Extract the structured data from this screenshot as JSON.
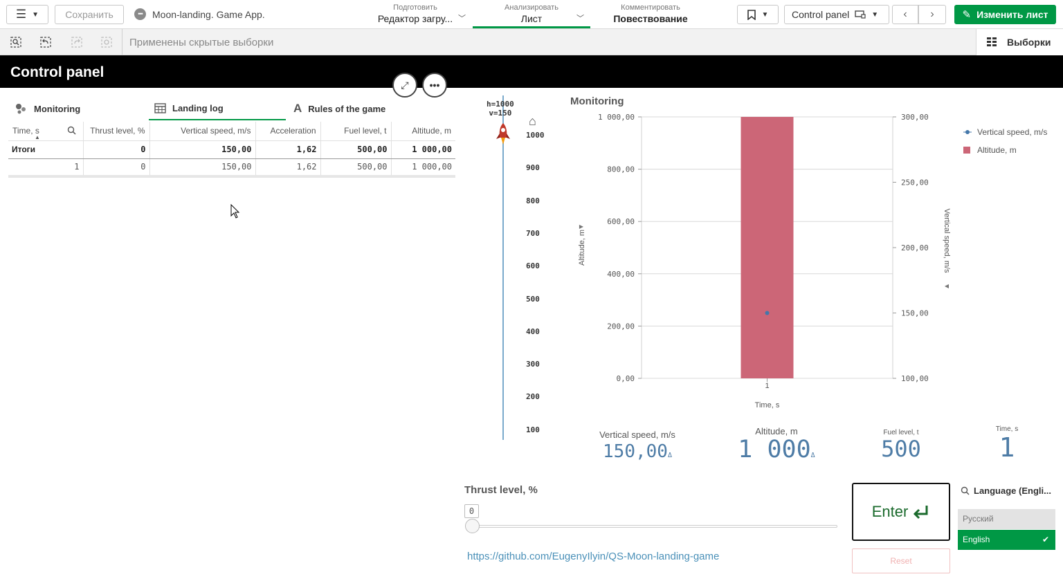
{
  "toolbar": {
    "save_label": "Сохранить",
    "app_name": "Moon-landing. Game App.",
    "nav": [
      {
        "small": "Подготовить",
        "big": "Редактор загру..."
      },
      {
        "small": "Анализировать",
        "big": "Лист"
      },
      {
        "small": "Комментировать",
        "big": "Повествование"
      }
    ],
    "sheet_name": "Control panel",
    "edit_label": "Изменить лист"
  },
  "selections": {
    "text": "Применены скрытые выборки",
    "right_label": "Выборки"
  },
  "sheet": {
    "title": "Control panel"
  },
  "tabs": [
    {
      "label": "Monitoring",
      "icon": "scatter-icon"
    },
    {
      "label": "Landing log",
      "icon": "table-icon"
    },
    {
      "label": "Rules of the game",
      "icon": "text-icon"
    }
  ],
  "log_table": {
    "headers": [
      "Time, s",
      "Thrust level, %",
      "Vertical speed, m/s",
      "Acceleration",
      "Fuel level, t",
      "Altitude, m"
    ],
    "totals": [
      "Итоги",
      "0",
      "150,00",
      "1,62",
      "500,00",
      "1 000,00"
    ],
    "rows": [
      [
        "1",
        "0",
        "150,00",
        "1,62",
        "500,00",
        "1 000,00"
      ]
    ]
  },
  "gauge": {
    "h_label": "h=1000",
    "v_label": "v=150",
    "ticks": [
      "1000",
      "900",
      "800",
      "700",
      "600",
      "500",
      "400",
      "300",
      "200",
      "100"
    ]
  },
  "chart": {
    "title": "Monitoring",
    "legend": [
      "Vertical speed, m/s",
      "Altitude, m"
    ],
    "colors": {
      "bar": "#cc6677",
      "point": "#4477aa"
    }
  },
  "chart_data": {
    "type": "bar",
    "categories": [
      "1"
    ],
    "series": [
      {
        "name": "Altitude, m",
        "type": "bar",
        "axis": "left",
        "values": [
          1000
        ]
      },
      {
        "name": "Vertical speed, m/s",
        "type": "scatter",
        "axis": "right",
        "values": [
          150
        ]
      }
    ],
    "xlabel": "Time, s",
    "ylabel": "Altitude, m",
    "y2label": "Vertical speed, m/s",
    "ylim": [
      0,
      1000
    ],
    "y2lim": [
      100,
      300
    ],
    "yticks": [
      "0,00",
      "200,00",
      "400,00",
      "600,00",
      "800,00",
      "1 000,00"
    ],
    "y2ticks": [
      "100,00",
      "150,00",
      "200,00",
      "250,00",
      "300,00"
    ],
    "grid": true,
    "legend_position": "top-right"
  },
  "kpis": [
    {
      "label": "Vertical speed, m/s",
      "value": "150,00",
      "suffix": "Δ"
    },
    {
      "label": "Altitude, m",
      "value": "1 000",
      "suffix": "Δ"
    },
    {
      "label": "Fuel level, t",
      "value": "500"
    },
    {
      "label": "Time, s",
      "value": "1"
    }
  ],
  "thrust": {
    "label": "Thrust level, %",
    "value": "0",
    "fraction": 0
  },
  "link": "https://github.com/EugenyIlyin/QS-Moon-landing-game",
  "enter_label": "Enter",
  "reset_label": "Reset",
  "language": {
    "title": "Language (Engli...",
    "options": [
      "Русский",
      "English"
    ],
    "selected": "English"
  }
}
